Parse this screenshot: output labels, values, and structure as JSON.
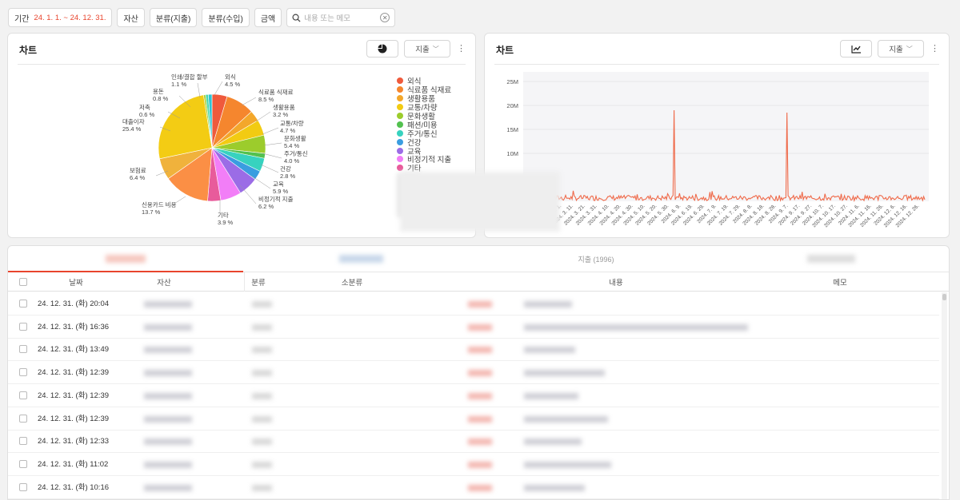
{
  "filters": {
    "period_label": "기간",
    "period_value": "24. 1. 1. ~ 24. 12. 31.",
    "asset": "자산",
    "category_expense": "분류(지출)",
    "category_income": "분류(수입)",
    "amount": "금액",
    "search_placeholder": "내용 또는 메모"
  },
  "pie_panel": {
    "title": "차트",
    "type_select": "지출",
    "chart_data": {
      "type": "pie",
      "slices": [
        {
          "name": "외식",
          "value": 4.5,
          "color": "#ef5a3c"
        },
        {
          "name": "식료품 식재료",
          "value": 8.5,
          "color": "#f5862e"
        },
        {
          "name": "생활용품",
          "value": 3.2,
          "color": "#f3a72b"
        },
        {
          "name": "교통/차량",
          "value": 4.7,
          "color": "#f2cb12"
        },
        {
          "name": "문화생활",
          "value": 5.4,
          "color": "#9ccc2c"
        },
        {
          "name": "패션/미용",
          "value": 1.5,
          "color": "#53c14f"
        },
        {
          "name": "주거/통신",
          "value": 4.0,
          "color": "#37d2bf"
        },
        {
          "name": "건강",
          "value": 2.8,
          "color": "#3a9de0"
        },
        {
          "name": "교육",
          "value": 5.9,
          "color": "#9b6ce6"
        },
        {
          "name": "비정기적 지출",
          "value": 6.2,
          "color": "#f27ef7"
        },
        {
          "name": "기타",
          "value": 3.9,
          "color": "#e85b9b"
        },
        {
          "name": "신용카드 비용",
          "value": 13.7,
          "color": "#fb8f45"
        },
        {
          "name": "보험료",
          "value": 6.4,
          "color": "#f0b23c"
        },
        {
          "name": "대출이자",
          "value": 25.4,
          "color": "#f3cc14"
        },
        {
          "name": "저축",
          "value": 0.6,
          "color": "#a8cf34"
        },
        {
          "name": "용돈",
          "value": 0.8,
          "color": "#4bd8a8"
        },
        {
          "name": "인쇄/결합 할부",
          "value": 1.1,
          "color": "#2fc4d4"
        }
      ],
      "labels": [
        {
          "name": "외식",
          "pct": "4.5 %"
        },
        {
          "name": "식료품 식재료",
          "pct": "8.5 %"
        },
        {
          "name": "생활용품",
          "pct": "3.2 %"
        },
        {
          "name": "교통/차량",
          "pct": "4.7 %"
        },
        {
          "name": "문화생활",
          "pct": "5.4 %"
        },
        {
          "name": "주거/통신",
          "pct": "4.0 %"
        },
        {
          "name": "건강",
          "pct": "2.8 %"
        },
        {
          "name": "교육",
          "pct": "5.9 %"
        },
        {
          "name": "비정기적 지출",
          "pct": "6.2 %"
        },
        {
          "name": "기타",
          "pct": "3.9 %"
        },
        {
          "name": "신용카드 비용",
          "pct": "13.7 %"
        },
        {
          "name": "보험료",
          "pct": "6.4 %"
        },
        {
          "name": "대출이자",
          "pct": "25.4 %"
        },
        {
          "name": "저축",
          "pct": "0.6 %"
        },
        {
          "name": "용돈",
          "pct": "0.8 %"
        },
        {
          "name": "인쇄/결합 할부",
          "pct": "1.1 %"
        }
      ]
    },
    "legend": [
      "외식",
      "식료품 식재료",
      "생활용품",
      "교통/차량",
      "문화생활",
      "패션/미용",
      "주거/통신",
      "건강",
      "교육",
      "비정기적 지출",
      "기타"
    ],
    "legend_colors": [
      "#ef5a3c",
      "#f5862e",
      "#f3a72b",
      "#f2cb12",
      "#9ccc2c",
      "#53c14f",
      "#37d2bf",
      "#3a9de0",
      "#9b6ce6",
      "#f27ef7",
      "#e85b9b"
    ]
  },
  "line_panel": {
    "title": "차트",
    "type_select": "지출",
    "chart_data": {
      "type": "line",
      "y_ticks": [
        "25M",
        "20M",
        "15M",
        "10M"
      ],
      "ylim": [
        0,
        27000000
      ],
      "x_ticks": [
        "2024. 1. 10.",
        "2024. 2. 20.",
        "2024. 3. 1.",
        "2024. 3. 11.",
        "2024. 3. 21.",
        "2024. 3. 31.",
        "2024. 4. 10.",
        "2024. 4. 20.",
        "2024. 4. 30.",
        "2024. 5. 10.",
        "2024. 5. 20.",
        "2024. 5. 30.",
        "2024. 6. 9.",
        "2024. 6. 19.",
        "2024. 6. 29.",
        "2024. 7. 9.",
        "2024. 7. 19.",
        "2024. 7. 29.",
        "2024. 8. 8.",
        "2024. 8. 18.",
        "2024. 8. 28.",
        "2024. 9. 7.",
        "2024. 9. 17.",
        "2024. 9. 27.",
        "2024. 10. 7.",
        "2024. 10. 17.",
        "2024. 10. 27.",
        "2024. 11. 6.",
        "2024. 11. 16.",
        "2024. 11. 26.",
        "2024. 12. 6.",
        "2024. 12. 16.",
        "2024. 12. 26."
      ],
      "series": [
        {
          "color": "#ef6a4a",
          "spikes": [
            {
              "x": "2024. 5. 8.",
              "value": 19000000
            },
            {
              "x": "2024. 8. 20.",
              "value": 18500000
            }
          ],
          "baseline": 600000
        }
      ]
    }
  },
  "table": {
    "tabs": [
      "",
      "",
      "지출 (1996)",
      ""
    ],
    "columns": [
      "날짜",
      "자산",
      "분류",
      "소분류",
      "",
      "내용",
      "메모"
    ],
    "rows": [
      {
        "date": "24. 12. 31. (화) 20:04"
      },
      {
        "date": "24. 12. 31. (화) 16:36"
      },
      {
        "date": "24. 12. 31. (화) 13:49"
      },
      {
        "date": "24. 12. 31. (화) 12:39"
      },
      {
        "date": "24. 12. 31. (화) 12:39"
      },
      {
        "date": "24. 12. 31. (화) 12:39"
      },
      {
        "date": "24. 12. 31. (화) 12:33"
      },
      {
        "date": "24. 12. 31. (화) 11:02"
      },
      {
        "date": "24. 12. 31. (화) 10:16"
      }
    ]
  }
}
